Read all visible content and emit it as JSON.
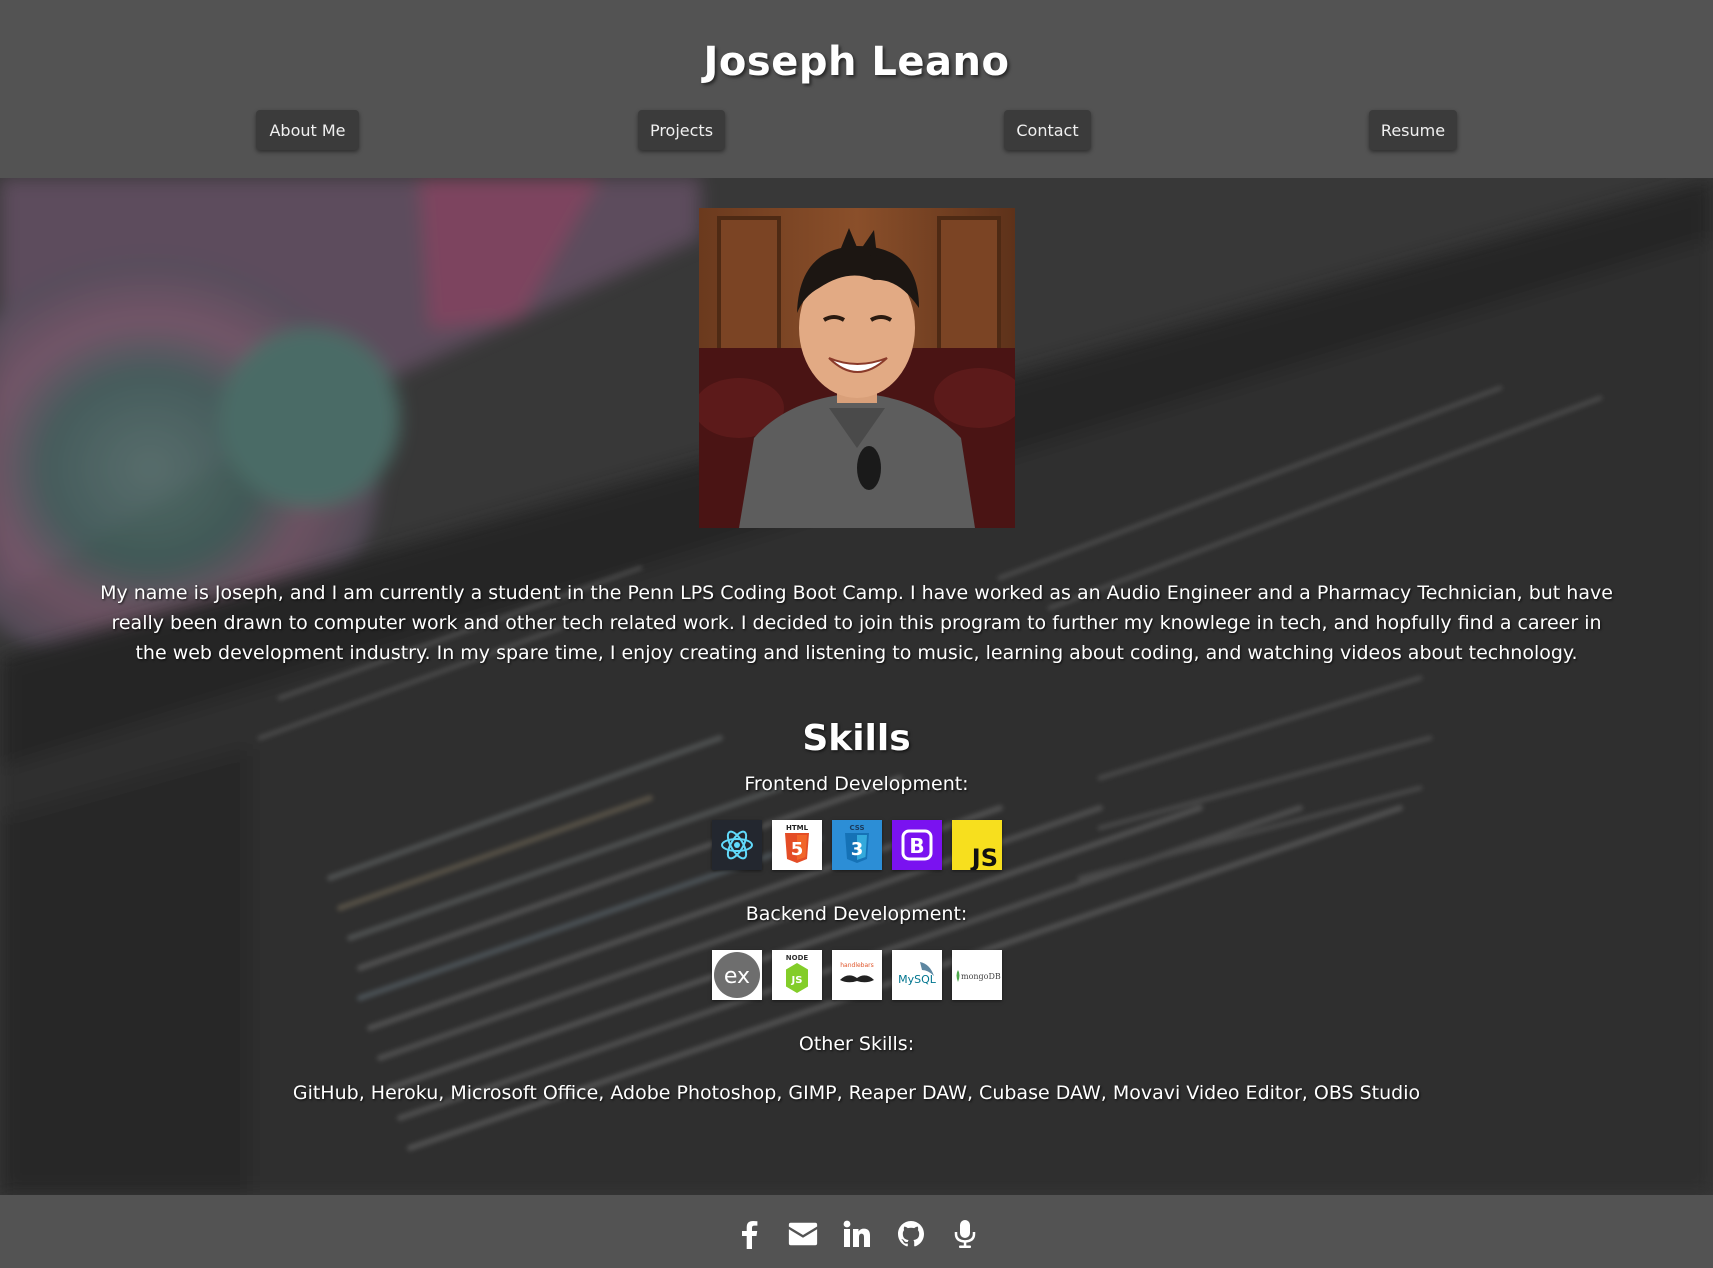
{
  "header": {
    "title": "Joseph Leano",
    "nav": [
      {
        "label": "About Me"
      },
      {
        "label": "Projects"
      },
      {
        "label": "Contact"
      },
      {
        "label": "Resume"
      }
    ]
  },
  "about": {
    "bio": "My name is Joseph, and I am currently a student in the Penn LPS Coding Boot Camp. I have worked as an Audio Engineer and a Pharmacy Technician, but have really been drawn to computer work and other tech related work. I decided to join this program to further my knowlege in tech, and hopfully find a career in the web development industry. In my spare time, I enjoy creating and listening to music, learning about coding, and watching videos about technology."
  },
  "skills": {
    "heading": "Skills",
    "frontend": {
      "label": "Frontend Development:",
      "icons": [
        {
          "name": "react-icon",
          "text": ""
        },
        {
          "name": "html5-icon",
          "text": "HTML"
        },
        {
          "name": "css3-icon",
          "text": "CSS"
        },
        {
          "name": "bootstrap-icon",
          "text": "B"
        },
        {
          "name": "javascript-icon",
          "text": "JS"
        }
      ]
    },
    "backend": {
      "label": "Backend Development:",
      "icons": [
        {
          "name": "express-icon",
          "text": "ex"
        },
        {
          "name": "nodejs-icon",
          "text": "NODE"
        },
        {
          "name": "handlebars-icon",
          "text": "handlebars"
        },
        {
          "name": "mysql-icon",
          "text": "MySQL"
        },
        {
          "name": "mongodb-icon",
          "text": "mongoDB"
        }
      ]
    },
    "other": {
      "label": "Other Skills:",
      "list": "GitHub, Heroku, Microsoft Office, Adobe Photoshop, GIMP, Reaper DAW, Cubase DAW, Movavi Video Editor, OBS Studio"
    }
  },
  "footer": {
    "icons": [
      "facebook-icon",
      "email-icon",
      "linkedin-icon",
      "github-icon",
      "microphone-icon"
    ]
  },
  "colors": {
    "header_bg": "#535353",
    "nav_button_bg": "#3b3b3b",
    "text": "#ffffff",
    "react_bg": "#23272f",
    "html_orange": "#e44d26",
    "css_blue": "#2c8ed6",
    "bootstrap_purple": "#7a12f0",
    "js_yellow": "#f7df1e"
  }
}
